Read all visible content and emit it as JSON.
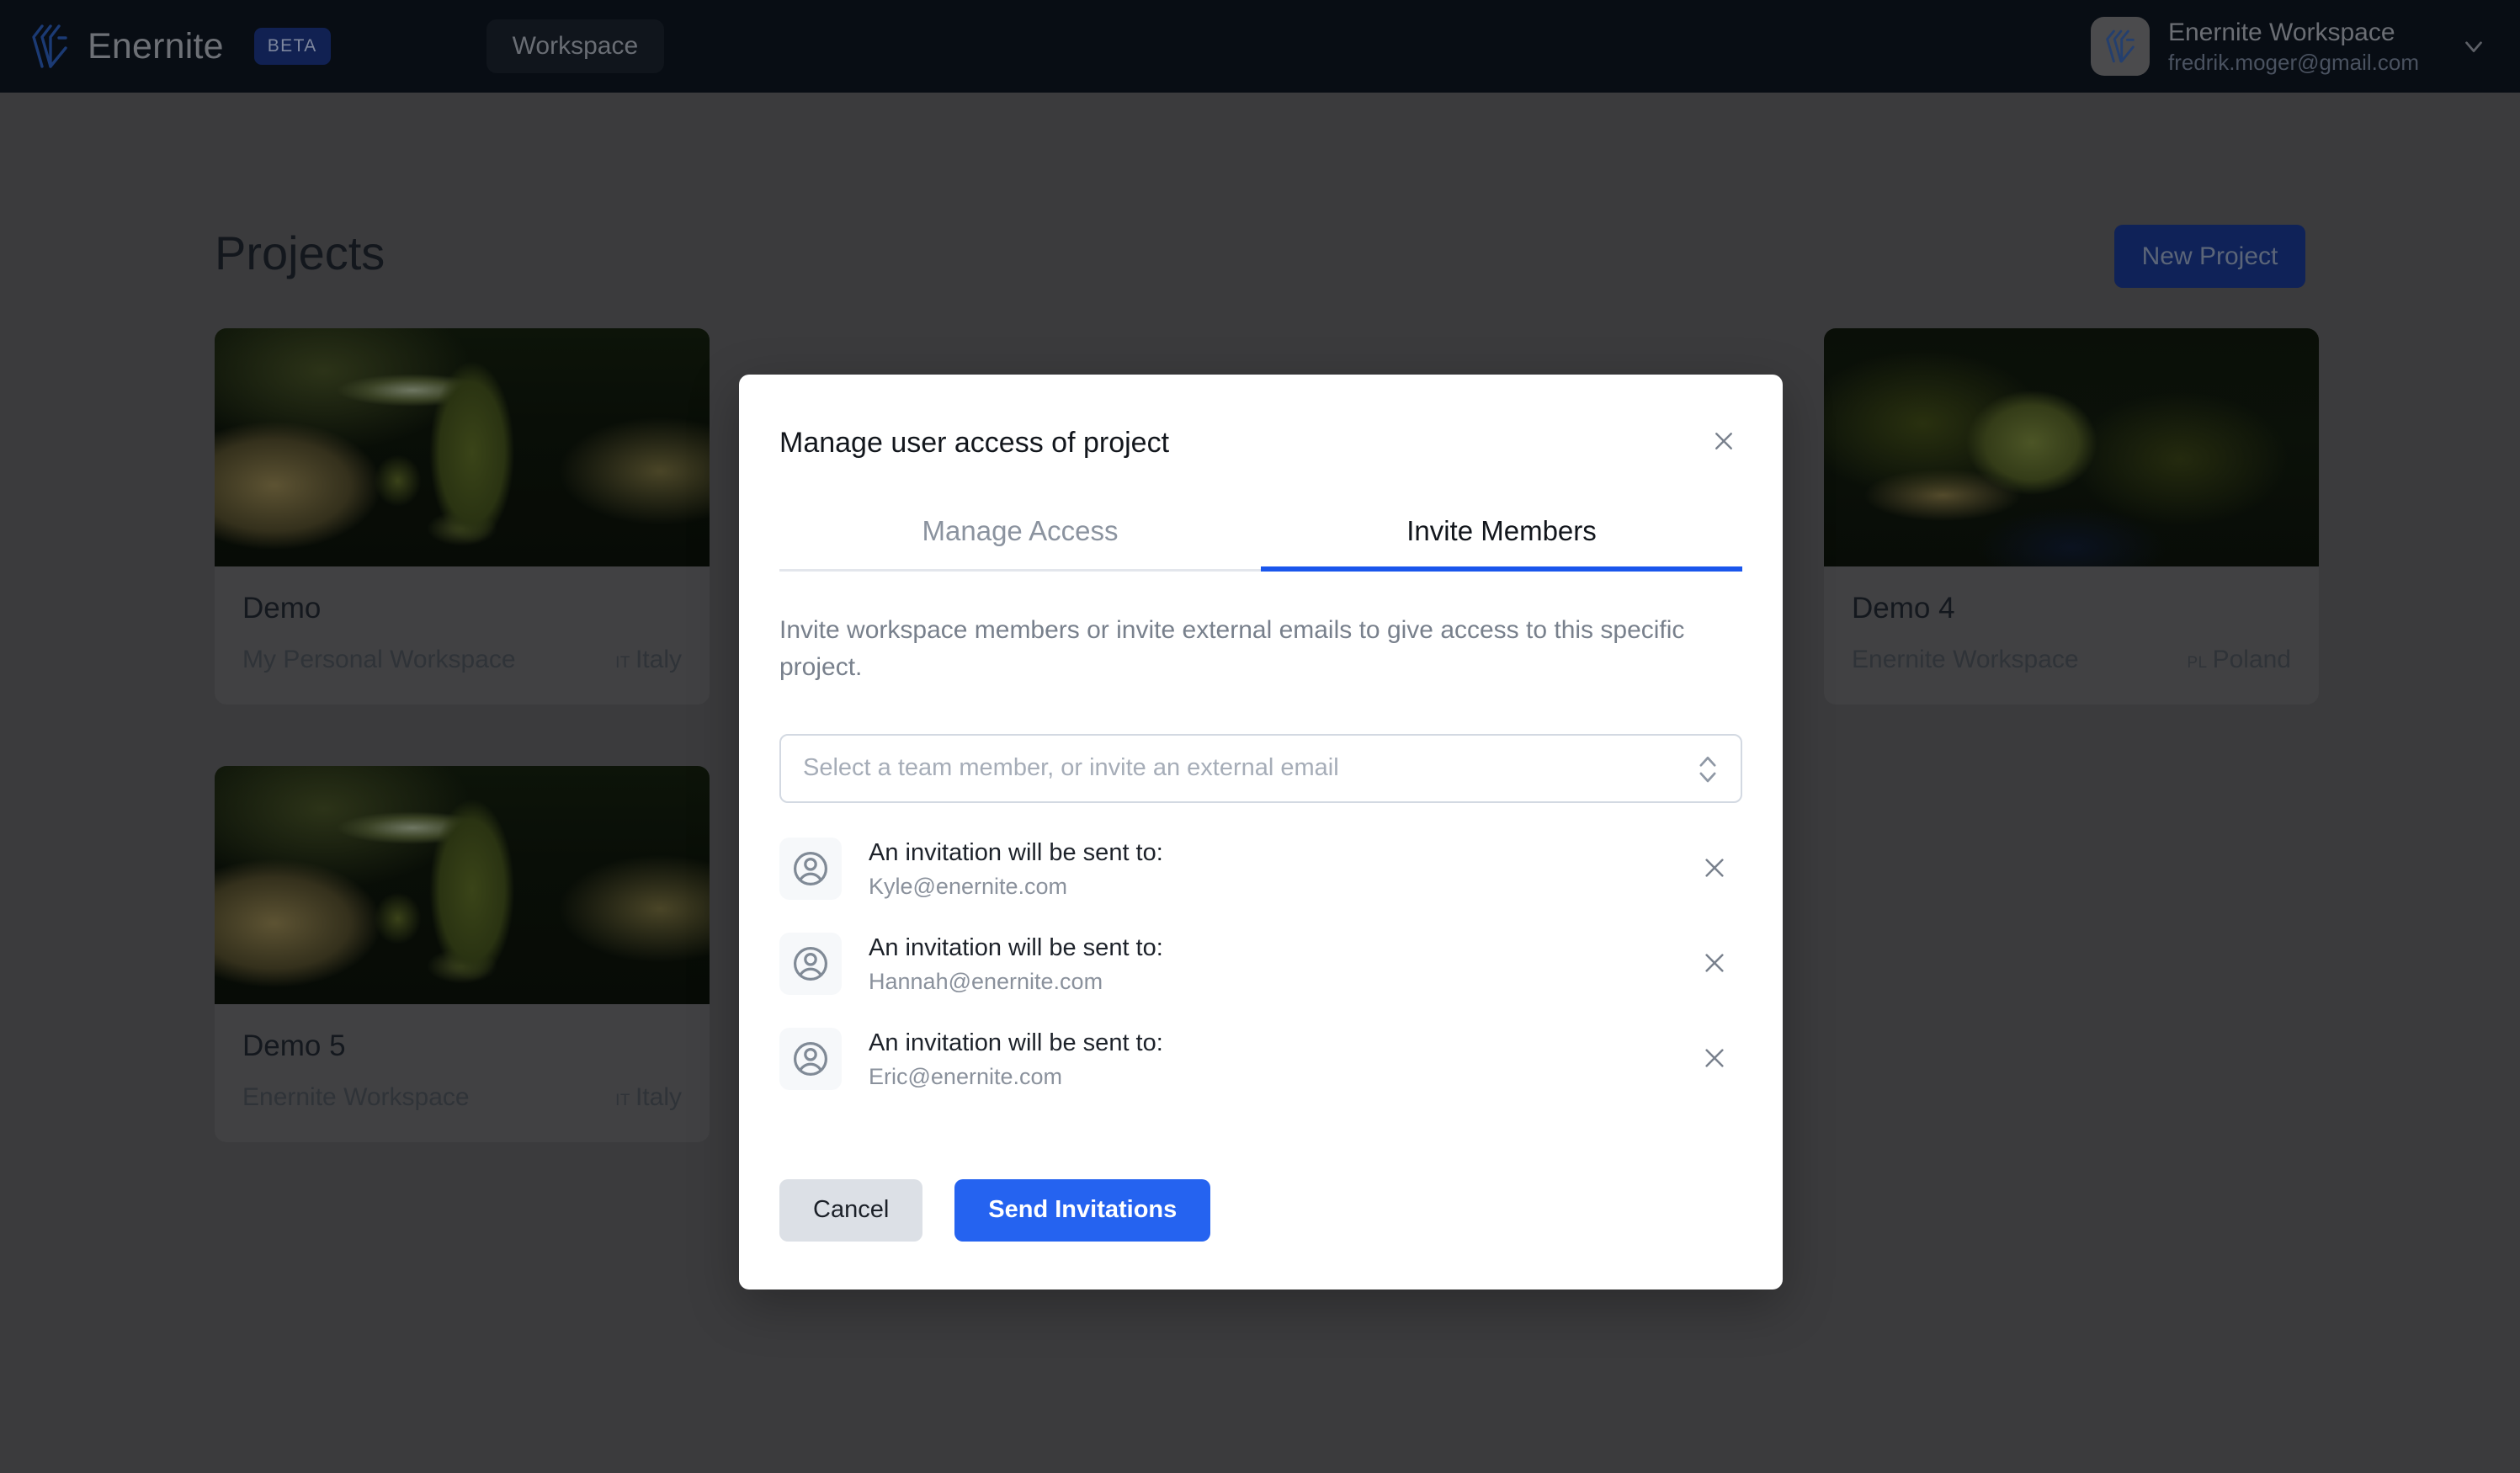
{
  "topbar": {
    "brand_name": "Enernite",
    "beta_label": "BETA",
    "nav_pill_label": "Workspace",
    "logo_icon": "enernite-logo-icon",
    "workspace_name": "Enernite Workspace",
    "workspace_email": "fredrik.moger@gmail.com",
    "workspace_avatar_icon": "enernite-logo-icon",
    "chevron_icon": "chevron-down-icon",
    "bar_color": "#080d14",
    "beta_badge_color": "#112152"
  },
  "page": {
    "title": "Projects",
    "new_project_label": "New Project",
    "new_project_color": "#0f2258",
    "background_color": "#3b3b3d",
    "projects": [
      {
        "name": "Demo",
        "workspace": "My Personal Workspace",
        "country_code": "IT",
        "country": "Italy",
        "thumb": "italy"
      },
      {
        "name": "Demo 4",
        "workspace": "Enernite Workspace",
        "country_code": "PL",
        "country": "Poland",
        "thumb": "poland"
      },
      {
        "name": "Demo 5",
        "workspace": "Enernite Workspace",
        "country_code": "IT",
        "country": "Italy",
        "thumb": "italy"
      }
    ]
  },
  "modal": {
    "title": "Manage user access of project",
    "close_icon": "close-icon",
    "tabs": [
      {
        "label": "Manage Access",
        "active": false
      },
      {
        "label": "Invite Members",
        "active": true
      }
    ],
    "active_tab_color": "#1a56ec",
    "description": "Invite workspace members or invite external emails to give access to this specific project.",
    "select": {
      "placeholder": "Select a team member, or invite an external email",
      "value": "",
      "chevron_icon": "chevron-up-down-icon"
    },
    "invitations": [
      {
        "label": "An invitation will be sent to:",
        "email": "Kyle@enernite.com",
        "avatar_icon": "user-circle-icon",
        "remove_icon": "close-icon"
      },
      {
        "label": "An invitation will be sent to:",
        "email": "Hannah@enernite.com",
        "avatar_icon": "user-circle-icon",
        "remove_icon": "close-icon"
      },
      {
        "label": "An invitation will be sent to:",
        "email": "Eric@enernite.com",
        "avatar_icon": "user-circle-icon",
        "remove_icon": "close-icon"
      }
    ],
    "cancel_label": "Cancel",
    "send_label": "Send Invitations",
    "send_button_color": "#2563f0",
    "cancel_button_color": "#dce0e6"
  }
}
